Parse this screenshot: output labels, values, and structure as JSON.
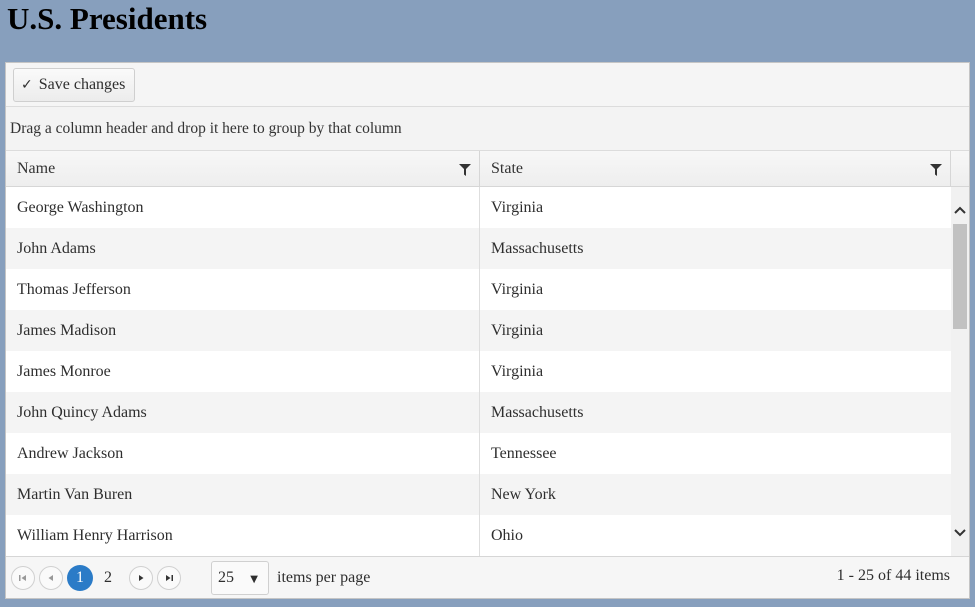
{
  "page": {
    "title": "U.S. Presidents"
  },
  "toolbar": {
    "save_label": "Save changes"
  },
  "group_panel": {
    "hint": "Drag a column header and drop it here to group by that column"
  },
  "columns": [
    {
      "label": "Name"
    },
    {
      "label": "State"
    }
  ],
  "rows": [
    {
      "name": "George Washington",
      "state": "Virginia"
    },
    {
      "name": "John Adams",
      "state": "Massachusetts"
    },
    {
      "name": "Thomas Jefferson",
      "state": "Virginia"
    },
    {
      "name": "James Madison",
      "state": "Virginia"
    },
    {
      "name": "James Monroe",
      "state": "Virginia"
    },
    {
      "name": "John Quincy Adams",
      "state": "Massachusetts"
    },
    {
      "name": "Andrew Jackson",
      "state": "Tennessee"
    },
    {
      "name": "Martin Van Buren",
      "state": "New York"
    },
    {
      "name": "William Henry Harrison",
      "state": "Ohio"
    }
  ],
  "pager": {
    "pages": [
      "1",
      "2"
    ],
    "current_page": "1",
    "page_size": "25",
    "items_per_page_label": "items per page",
    "info": "1 - 25 of 44 items"
  },
  "colors": {
    "background": "#879fbd",
    "accent": "#2b7bc7"
  },
  "icons": [
    "check-icon",
    "filter-icon",
    "scroll-up-icon",
    "scroll-down-icon",
    "first-page-icon",
    "prev-page-icon",
    "next-page-icon",
    "last-page-icon",
    "dropdown-caret-icon"
  ]
}
